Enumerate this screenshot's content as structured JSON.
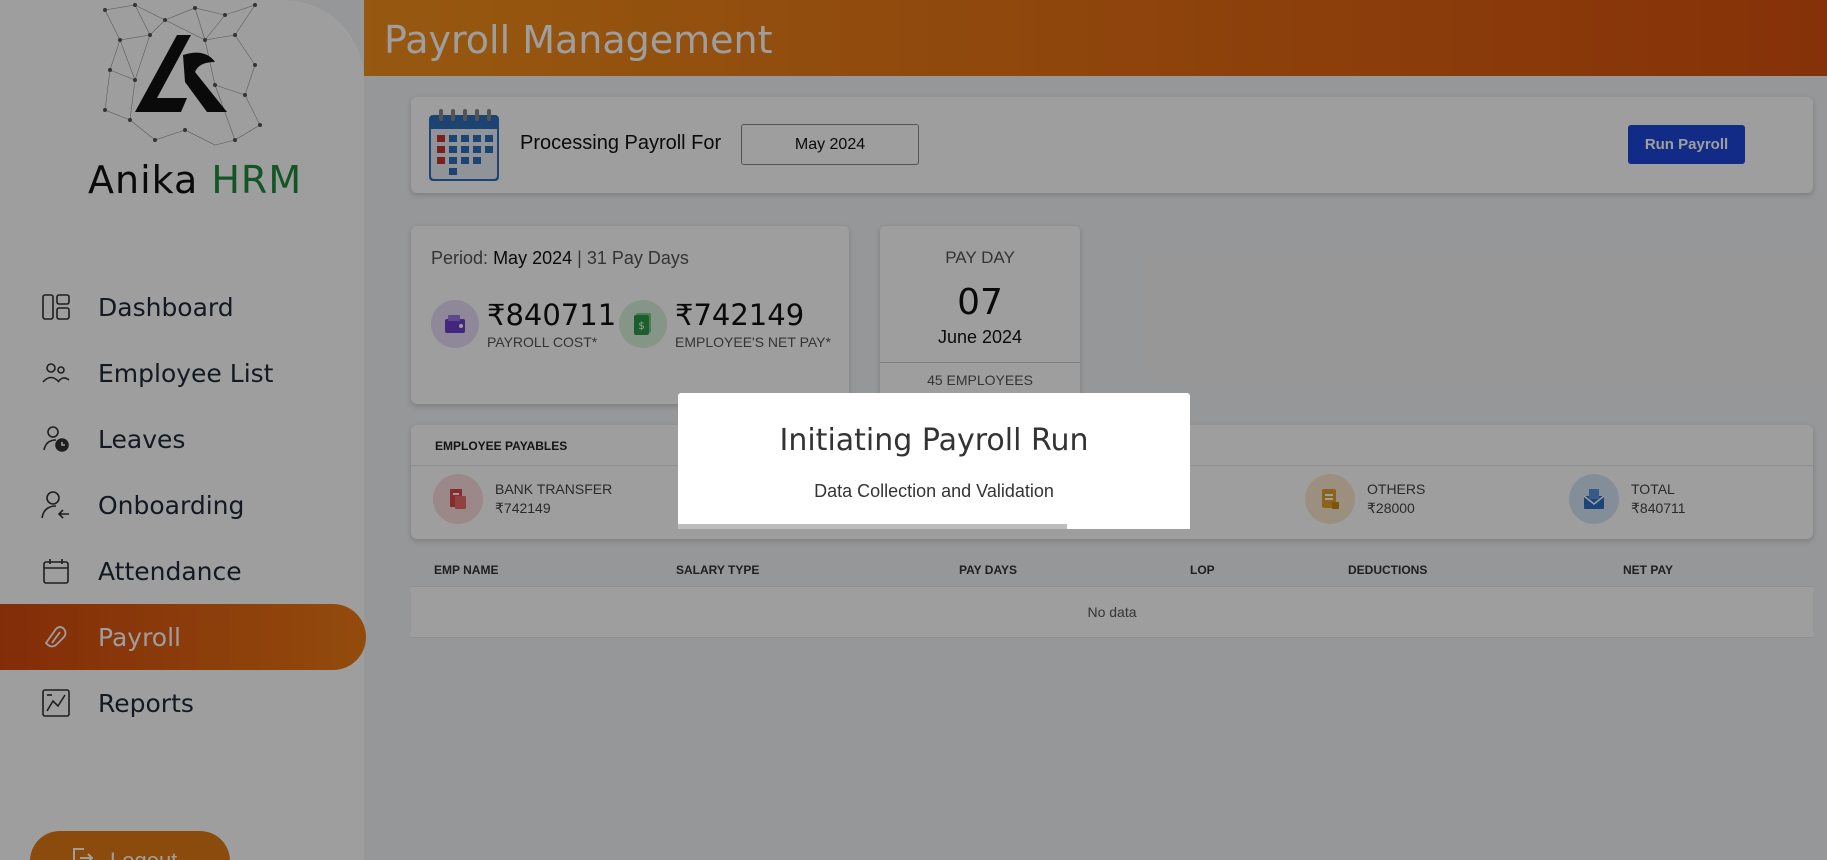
{
  "sidebar": {
    "brand_name": "Anika",
    "brand_suffix": "HRM",
    "items": [
      {
        "label": "Dashboard",
        "icon": "dashboard-icon"
      },
      {
        "label": "Employee List",
        "icon": "users-icon"
      },
      {
        "label": "Leaves",
        "icon": "user-clock-icon"
      },
      {
        "label": "Onboarding",
        "icon": "user-arrow-icon"
      },
      {
        "label": "Attendance",
        "icon": "calendar-icon"
      },
      {
        "label": "Payroll",
        "icon": "payroll-icon",
        "active": true
      },
      {
        "label": "Reports",
        "icon": "chart-icon"
      }
    ],
    "logout_label": "Logout"
  },
  "header": {
    "title": "Payroll Management"
  },
  "processing": {
    "label": "Processing Payroll For",
    "month": "May 2024",
    "run_button": "Run Payroll"
  },
  "period": {
    "prefix": "Period:",
    "month": "May 2024",
    "separator": " | ",
    "paydays": "31 Pay Days",
    "payroll_cost": "₹840711",
    "payroll_cost_label": "PAYROLL COST*",
    "net_pay": "₹742149",
    "net_pay_label": "EMPLOYEE'S NET PAY*"
  },
  "payday": {
    "label": "PAY DAY",
    "day": "07",
    "month_year": "June 2024",
    "employees": "45 EMPLOYEES"
  },
  "payables": {
    "title": "EMPLOYEE PAYABLES",
    "items": [
      {
        "label": "BANK TRANSFER",
        "value": "₹742149"
      },
      {
        "label": "OTHERS",
        "value": "₹28000"
      },
      {
        "label": "TOTAL",
        "value": "₹840711"
      }
    ]
  },
  "table": {
    "columns": [
      "EMP NAME",
      "SALARY TYPE",
      "PAY DAYS",
      "LOP",
      "DEDUCTIONS",
      "NET PAY"
    ],
    "empty": "No data"
  },
  "modal": {
    "title": "Initiating Payroll Run",
    "subtitle": "Data Collection and Validation",
    "progress": 0.76
  },
  "colors": {
    "accent": "#e0630f",
    "brand_green": "#1f8a3a",
    "button_blue": "#1c46d8"
  }
}
